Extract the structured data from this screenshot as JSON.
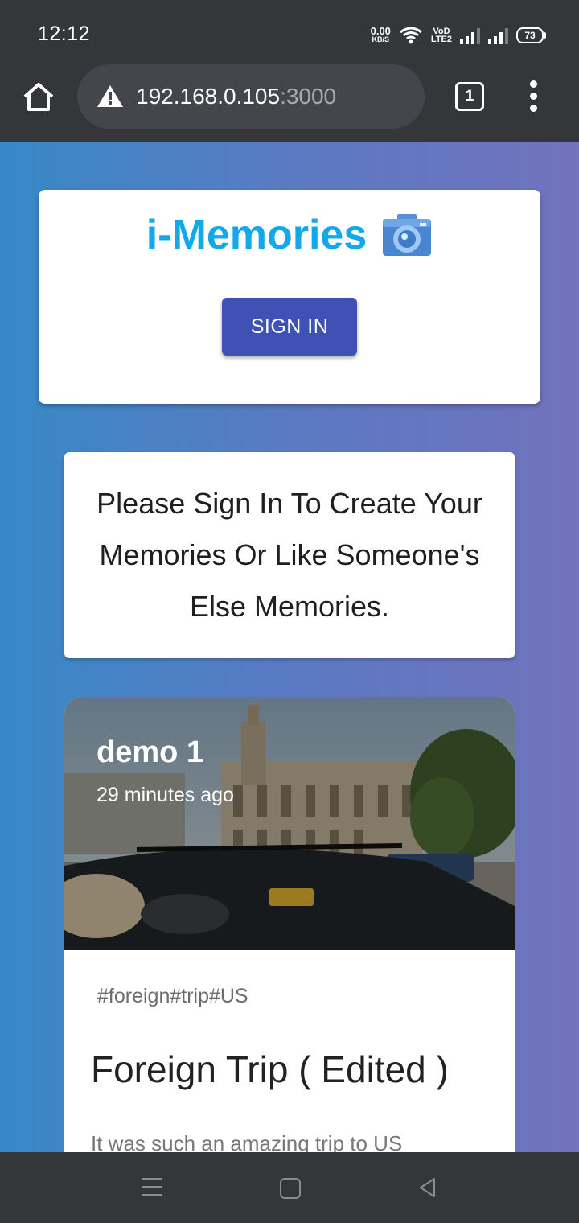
{
  "status_bar": {
    "time": "12:12",
    "net_speed_value": "0.00",
    "net_speed_unit": "KB/S",
    "volte_line1": "VoD",
    "volte_line2": "LTE2",
    "battery": "73"
  },
  "browser": {
    "url_host": "192.168.0.105",
    "url_port": ":3000",
    "tab_count": "1"
  },
  "header": {
    "title": "i-Memories",
    "logo_icon": "camera-icon",
    "signin_label": "SIGN IN"
  },
  "notice": {
    "text": "Please Sign In To Create Your Memories Or Like Someone's Else Memories."
  },
  "post": {
    "author": "demo 1",
    "time_ago": "29 minutes ago",
    "tags": "#foreign#trip#US",
    "title": "Foreign Trip ( Edited )",
    "message": "It was such an amazing trip to US"
  },
  "colors": {
    "brand": "#13a8e8",
    "primary": "#3f51b5",
    "gradient_start": "#3789c7",
    "gradient_end": "#7272bd"
  }
}
